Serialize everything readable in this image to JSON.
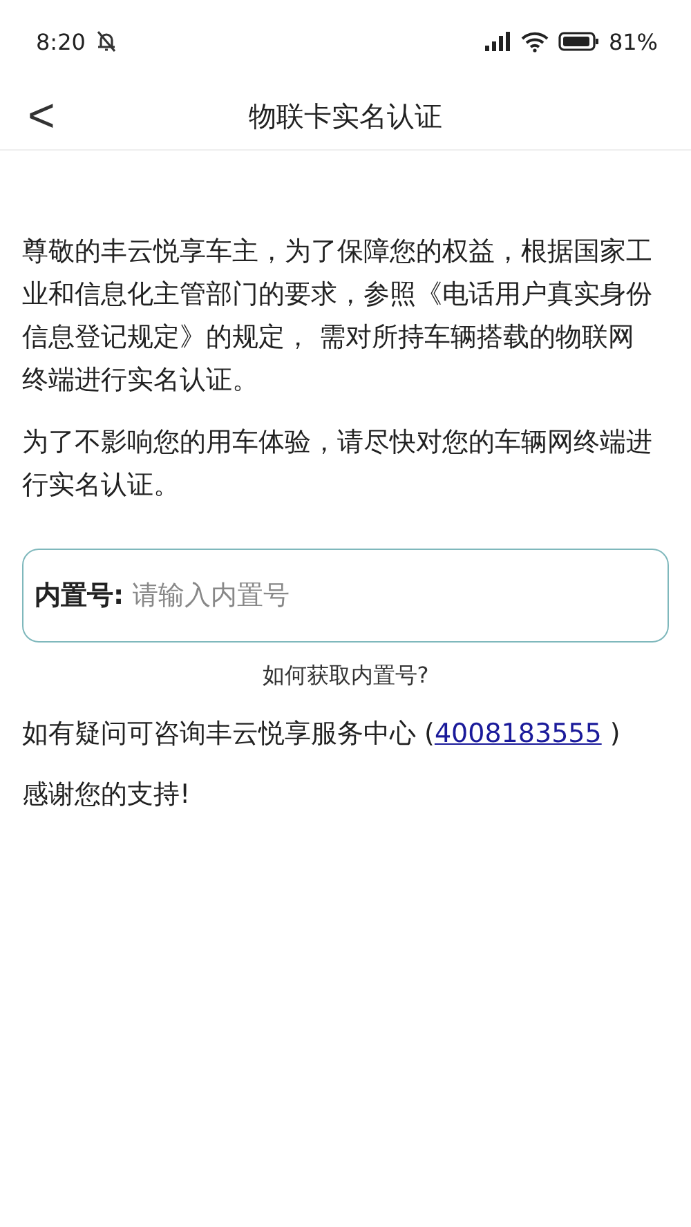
{
  "status_bar": {
    "time": "8:20",
    "battery": "81%"
  },
  "header": {
    "back": "<",
    "title": "物联卡实名认证"
  },
  "paragraphs": [
    "尊敬的丰云悦享车主，为了保障您的权益，根据国家工业和信息化主管部门的要求，参照《电话用户真实身份信息登记规定》的规定， 需对所持车辆搭载的物联网终端进行实名认证。",
    "为了不影响您的用车体验，请尽快对您的车辆网终端进行实名认证。"
  ],
  "field": {
    "label": "内置号:",
    "placeholder": "请输入内置号"
  },
  "help_link": "如何获取内置号?",
  "contact": {
    "before": "如有疑问可咨询丰云悦享服务中心 (",
    "link": "4008183555",
    "after": " )"
  },
  "thanks": "感谢您的支持!"
}
